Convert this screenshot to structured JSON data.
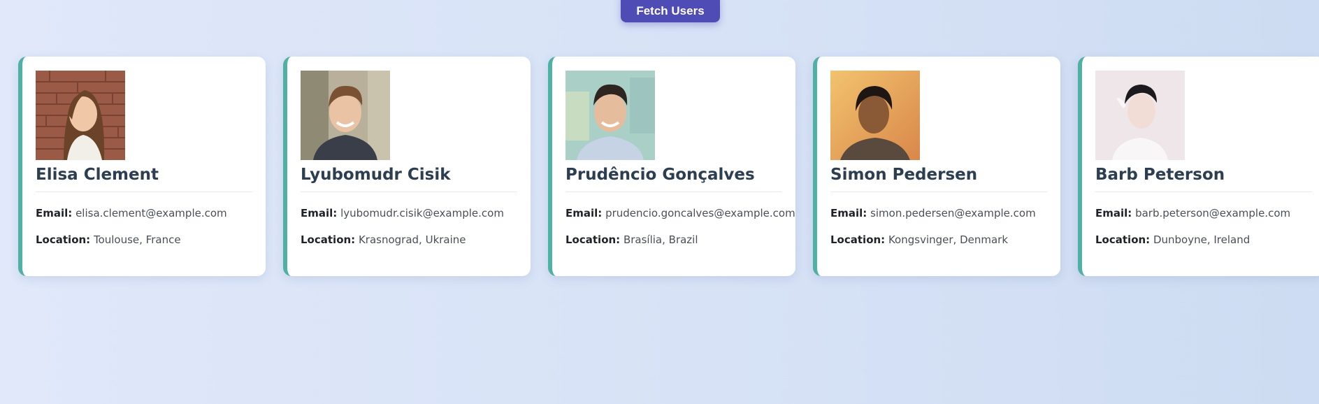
{
  "toolbar": {
    "fetch_label": "Fetch Users"
  },
  "labels": {
    "email": "Email:",
    "location": "Location:"
  },
  "colors": {
    "accent_border": "#4fb0a4",
    "button": "#4f4db5",
    "name_text": "#2c3e50"
  },
  "users": [
    {
      "name": "Elisa Clement",
      "email": "elisa.clement@example.com",
      "location": "Toulouse, France"
    },
    {
      "name": "Lyubomudr Cisik",
      "email": "lyubomudr.cisik@example.com",
      "location": "Krasnograd, Ukraine"
    },
    {
      "name": "Prudêncio Gonçalves",
      "email": "prudencio.goncalves@example.com",
      "location": "Brasília, Brazil"
    },
    {
      "name": "Simon Pedersen",
      "email": "simon.pedersen@example.com",
      "location": "Kongsvinger, Denmark"
    },
    {
      "name": "Barb Peterson",
      "email": "barb.peterson@example.com",
      "location": "Dunboyne, Ireland"
    }
  ]
}
